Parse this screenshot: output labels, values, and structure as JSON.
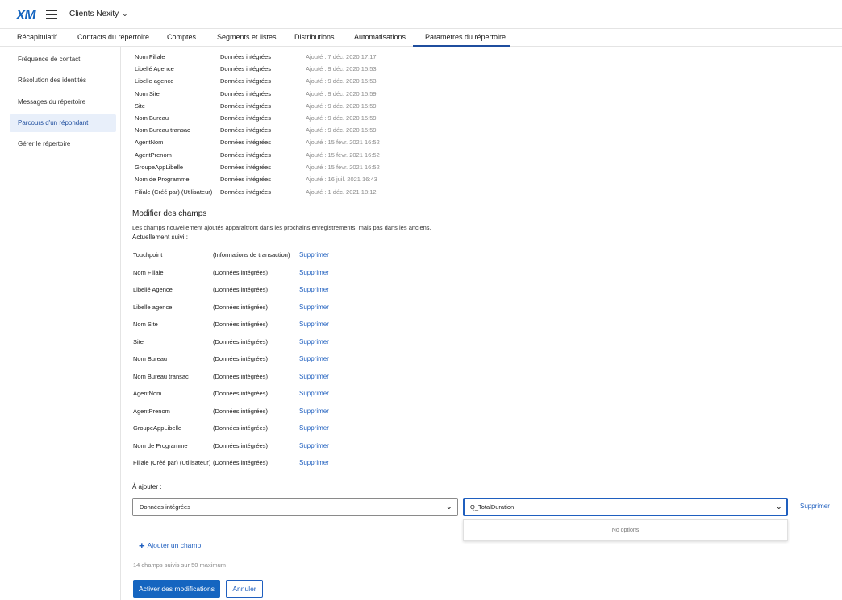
{
  "header": {
    "logo": "XM",
    "project": "Clients Nexity"
  },
  "tabs": [
    {
      "label": "Récapitulatif"
    },
    {
      "label": "Contacts du répertoire"
    },
    {
      "label": "Comptes"
    },
    {
      "label": "Segments et listes"
    },
    {
      "label": "Distributions"
    },
    {
      "label": "Automatisations"
    },
    {
      "label": "Paramètres du répertoire"
    }
  ],
  "sidebar": {
    "items": [
      {
        "label": "Fréquence de contact"
      },
      {
        "label": "Résolution des identités"
      },
      {
        "label": "Messages du répertoire"
      },
      {
        "label": "Parcours d'un répondant"
      },
      {
        "label": "Gérer le répertoire"
      }
    ]
  },
  "fields": [
    {
      "name": "Nom Filiale",
      "type": "Données intégrées",
      "added": "Ajouté : 7 déc. 2020 17:17"
    },
    {
      "name": "Libellé Agence",
      "type": "Données intégrées",
      "added": "Ajouté : 9 déc. 2020 15:53"
    },
    {
      "name": "Libelle agence",
      "type": "Données intégrées",
      "added": "Ajouté : 9 déc. 2020 15:53"
    },
    {
      "name": "Nom Site",
      "type": "Données intégrées",
      "added": "Ajouté : 9 déc. 2020 15:59"
    },
    {
      "name": "Site",
      "type": "Données intégrées",
      "added": "Ajouté : 9 déc. 2020 15:59"
    },
    {
      "name": "Nom Bureau",
      "type": "Données intégrées",
      "added": "Ajouté : 9 déc. 2020 15:59"
    },
    {
      "name": "Nom Bureau transac",
      "type": "Données intégrées",
      "added": "Ajouté : 9 déc. 2020 15:59"
    },
    {
      "name": "AgentNom",
      "type": "Données intégrées",
      "added": "Ajouté : 15 févr. 2021 16:52"
    },
    {
      "name": "AgentPrenom",
      "type": "Données intégrées",
      "added": "Ajouté : 15 févr. 2021 16:52"
    },
    {
      "name": "GroupeAppLibelle",
      "type": "Données intégrées",
      "added": "Ajouté : 15 févr. 2021 16:52"
    },
    {
      "name": "Nom de Programme",
      "type": "Données intégrées",
      "added": "Ajouté : 16 juil. 2021 16:43"
    },
    {
      "name": "Filiale (Créé par) (Utilisateur)",
      "type": "Données intégrées",
      "added": "Ajouté : 1 déc. 2021 18:12"
    }
  ],
  "modify": {
    "title": "Modifier des champs",
    "info": "Les champs nouvellement ajoutés apparaîtront dans les prochains enregistrements, mais pas dans les anciens.",
    "tracked_label": "Actuellement suivi :"
  },
  "tracked": [
    {
      "name": "Touchpoint",
      "type": "(Informations de transaction)",
      "action": "Supprimer"
    },
    {
      "name": "Nom Filiale",
      "type": "(Données intégrées)",
      "action": "Supprimer"
    },
    {
      "name": "Libellé Agence",
      "type": "(Données intégrées)",
      "action": "Supprimer"
    },
    {
      "name": "Libelle agence",
      "type": "(Données intégrées)",
      "action": "Supprimer"
    },
    {
      "name": "Nom Site",
      "type": "(Données intégrées)",
      "action": "Supprimer"
    },
    {
      "name": "Site",
      "type": "(Données intégrées)",
      "action": "Supprimer"
    },
    {
      "name": "Nom Bureau",
      "type": "(Données intégrées)",
      "action": "Supprimer"
    },
    {
      "name": "Nom Bureau transac",
      "type": "(Données intégrées)",
      "action": "Supprimer"
    },
    {
      "name": "AgentNom",
      "type": "(Données intégrées)",
      "action": "Supprimer"
    },
    {
      "name": "AgentPrenom",
      "type": "(Données intégrées)",
      "action": "Supprimer"
    },
    {
      "name": "GroupeAppLibelle",
      "type": "(Données intégrées)",
      "action": "Supprimer"
    },
    {
      "name": "Nom de Programme",
      "type": "(Données intégrées)",
      "action": "Supprimer"
    },
    {
      "name": "Filiale (Créé par) (Utilisateur)",
      "type": "(Données intégrées)",
      "action": "Supprimer"
    }
  ],
  "add": {
    "label": "À ajouter :",
    "type_select": "Données intégrées",
    "field_select": "Q_TotalDuration",
    "remove": "Supprimer",
    "no_options": "No options",
    "add_field": "Ajouter un champ",
    "count": "14 champs suivis sur 50 maximum"
  },
  "actions": {
    "apply": "Activer des modifications",
    "cancel": "Annuler"
  },
  "colors": {
    "accent": "#1565c0",
    "link": "#1f5fbf",
    "active_tab_underline": "#1f4e9e"
  }
}
